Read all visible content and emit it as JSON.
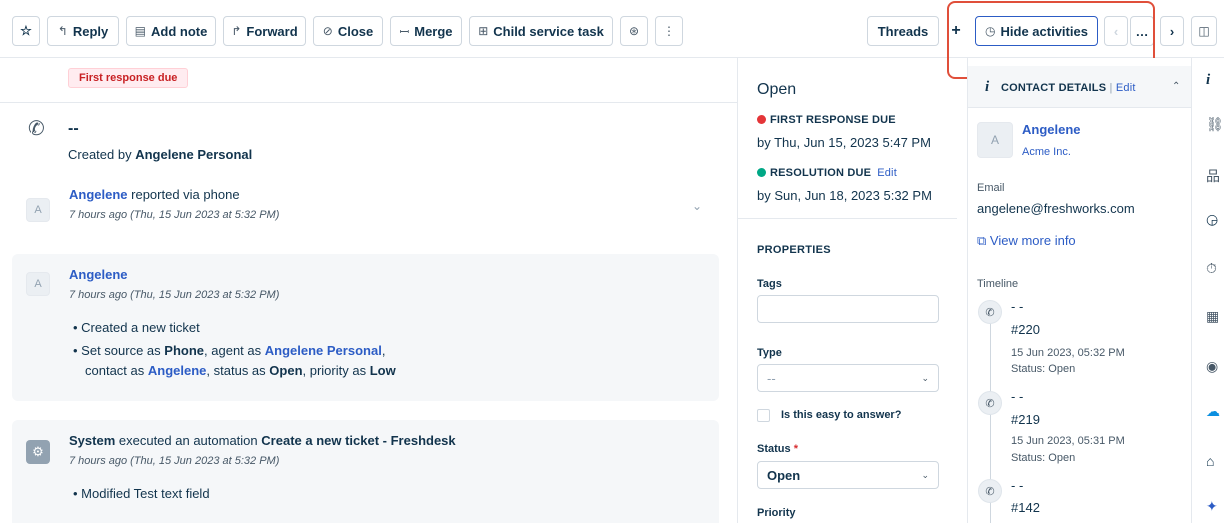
{
  "toolbar": {
    "reply": "Reply",
    "add_note": "Add note",
    "forward": "Forward",
    "close": "Close",
    "merge": "Merge",
    "child_task": "Child service task",
    "threads": "Threads",
    "plus": "+",
    "hide_activities": "Hide activities",
    "more": "⋮",
    "prev": "‹",
    "ellipsis": "…",
    "next": "›"
  },
  "conversation": {
    "badge": "First response due",
    "title": "--",
    "created_by_prefix": "Created by",
    "created_by_name": "Angelene Personal",
    "reported": {
      "avatar": "A",
      "name": "Angelene",
      "action": "reported via phone",
      "time": "7 hours ago (Thu, 15 Jun 2023 at 5:32 PM)"
    },
    "activity": {
      "avatar": "A",
      "name": "Angelene",
      "time": "7 hours ago (Thu, 15 Jun 2023 at 5:32 PM)",
      "bullet1": "Created a new ticket",
      "b2_prefix": "Set source as",
      "b2_source": "Phone",
      "b2_agent_prefix": ", agent as",
      "b2_agent": "Angelene Personal",
      "b2_end": ",",
      "b3_prefix": "contact as",
      "b3_contact": "Angelene",
      "b3_status_prefix": ", status as",
      "b3_status": "Open",
      "b3_priority_prefix": ", priority as",
      "b3_priority": "Low"
    },
    "system": {
      "name": "System",
      "action": "executed an automation",
      "automation": "Create a new ticket - Freshdesk",
      "time": "7 hours ago (Thu, 15 Jun 2023 at 5:32 PM)",
      "bullet1": "Modified Test text field"
    }
  },
  "properties": {
    "status_title": "Open",
    "frd_label": "FIRST RESPONSE DUE",
    "frd_value": "by Thu, Jun 15, 2023 5:47 PM",
    "rd_label": "RESOLUTION DUE",
    "rd_edit": "Edit",
    "rd_value": "by Sun, Jun 18, 2023 5:32 PM",
    "heading": "PROPERTIES",
    "tags_label": "Tags",
    "type_label": "Type",
    "type_value": "--",
    "easy_label": "Is this easy to answer?",
    "status_label": "Status",
    "status_req": "*",
    "status_value": "Open",
    "priority_label": "Priority"
  },
  "contact": {
    "header": "CONTACT DETAILS",
    "sep": "|",
    "edit": "Edit",
    "avatar": "A",
    "name": "Angelene",
    "company": "Acme Inc.",
    "email_label": "Email",
    "email": "angelene@freshworks.com",
    "view_more": "View more info",
    "timeline_label": "Timeline",
    "timeline": [
      {
        "title": "- -",
        "id": "#220",
        "date": "15 Jun 2023, 05:32 PM",
        "status": "Status: Open"
      },
      {
        "title": "- -",
        "id": "#219",
        "date": "15 Jun 2023, 05:31 PM",
        "status": "Status: Open"
      },
      {
        "title": "- -",
        "id": "#142"
      }
    ]
  },
  "colors": {
    "accent": "#2c5cc5",
    "overdue": "#e43538",
    "on_track": "#00a886",
    "highlight_box": "#e04f3a"
  }
}
